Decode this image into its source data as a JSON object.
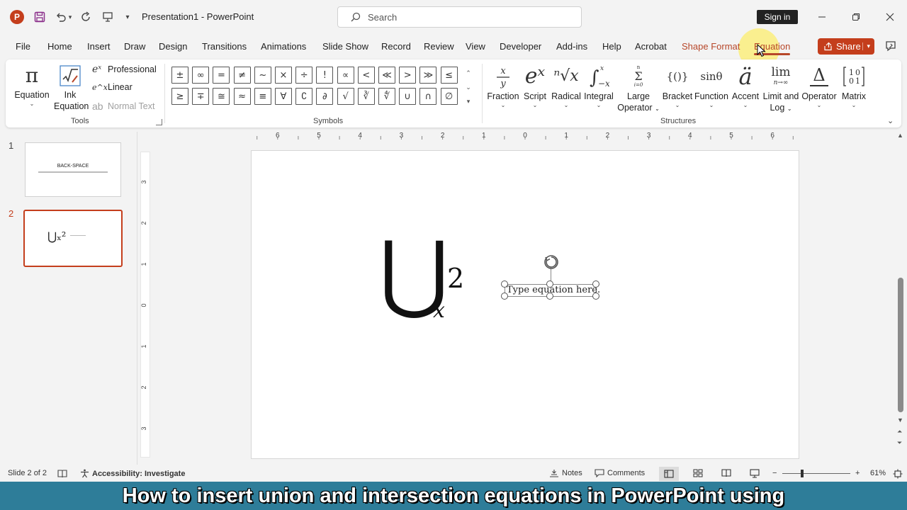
{
  "app": {
    "logo": "P",
    "title": "Presentation1  -  PowerPoint",
    "search_placeholder": "Search",
    "signin_label": "Sign in",
    "share_label": "Share"
  },
  "tabs": [
    "File",
    "Home",
    "Insert",
    "Draw",
    "Design",
    "Transitions",
    "Animations",
    "Slide Show",
    "Record",
    "Review",
    "View",
    "Developer",
    "Add-ins",
    "Help",
    "Acrobat",
    "Shape Format",
    "Equation"
  ],
  "active_tab": "Equation",
  "ribbon": {
    "tools": {
      "label": "Tools",
      "equation": {
        "glyph": "π",
        "line1": "Equation"
      },
      "ink": {
        "line1": "Ink",
        "line2": "Equation"
      },
      "professional": {
        "glyph": "eˣ",
        "label": "Professional"
      },
      "linear": {
        "glyph": "e^x",
        "label": "Linear"
      },
      "normal_text": {
        "glyph": "ab",
        "label": "Normal Text"
      }
    },
    "symbols": {
      "label": "Symbols",
      "row1": [
        "±",
        "∞",
        "=",
        "≠",
        "~",
        "×",
        "÷",
        "!",
        "∝",
        "<",
        "≪",
        ">",
        "≫",
        "≤"
      ],
      "row2": [
        "≥",
        "∓",
        "≅",
        "≈",
        "≡",
        "∀",
        "∁",
        "∂",
        "√",
        "∛",
        "∜",
        "∪",
        "∩",
        "∅"
      ]
    },
    "structures": {
      "label": "Structures",
      "items": [
        {
          "line1": "Fraction",
          "line2": ""
        },
        {
          "line1": "Script",
          "line2": ""
        },
        {
          "line1": "Radical",
          "line2": ""
        },
        {
          "line1": "Integral",
          "line2": ""
        },
        {
          "line1": "Large",
          "line2": "Operator"
        },
        {
          "line1": "Bracket",
          "line2": ""
        },
        {
          "line1": "Function",
          "line2": ""
        },
        {
          "line1": "Accent",
          "line2": ""
        },
        {
          "line1": "Limit and",
          "line2": "Log"
        },
        {
          "line1": "Operator",
          "line2": ""
        },
        {
          "line1": "Matrix",
          "line2": ""
        }
      ],
      "glyphs": {
        "script": "eˣ",
        "radical": "ⁿ√x",
        "large_operator": "Σ",
        "large_operator_top": "n",
        "large_operator_bottom": "i=0",
        "bracket": "{()}",
        "function": "sinθ",
        "accent": "ä",
        "limit": "lim",
        "limit_sub": "n→∞",
        "operator": "Δ",
        "matrix": "1 0\n0 1"
      }
    }
  },
  "slides": {
    "thumb1_num": "1",
    "thumb1_title": "BACK-SPACE",
    "thumb2_num": "2",
    "thumb2_eq": "⋃ₓ²"
  },
  "ruler": {
    "h_labels": [
      "6",
      "5",
      "4",
      "3",
      "2",
      "1",
      "0",
      "1",
      "2",
      "3",
      "4",
      "5",
      "6"
    ],
    "v_labels": [
      "3",
      "2",
      "1",
      "0",
      "1",
      "2",
      "3"
    ]
  },
  "slide": {
    "union": "⋃",
    "sub": "x",
    "sup": "2",
    "placeholder": "Type equation here."
  },
  "status": {
    "slide_info": "Slide 2 of 2",
    "accessibility": "Accessibility: Investigate",
    "notes": "Notes",
    "comments": "Comments",
    "zoom": "61%"
  },
  "caption": "How to insert union and intersection equations in PowerPoint using",
  "colors": {
    "accent": "#c43e1c",
    "caption_bg": "#2e7d99"
  }
}
